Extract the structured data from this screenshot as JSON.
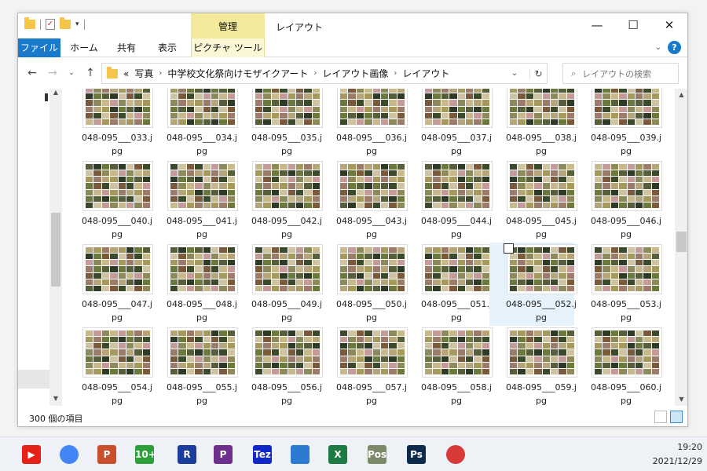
{
  "window": {
    "title": "レイアウト",
    "context_tab_group": "管理",
    "controls": {
      "minimize": "—",
      "maximize": "☐",
      "close": "✕"
    }
  },
  "ribbon": {
    "tabs": [
      {
        "label": "ファイル",
        "active": true
      },
      {
        "label": "ホーム"
      },
      {
        "label": "共有"
      },
      {
        "label": "表示"
      },
      {
        "label": "ピクチャ ツール"
      }
    ],
    "expand_icon": "chevron-down-icon",
    "help_label": "?"
  },
  "address_bar": {
    "overflow": "«",
    "crumbs": [
      "写真",
      "中学校文化祭向けモザイクアート",
      "レイアウト画像",
      "レイアウト"
    ]
  },
  "search": {
    "placeholder": "レイアウトの検索"
  },
  "files": [
    {
      "name": "048-095___033.jpg"
    },
    {
      "name": "048-095___034.jpg"
    },
    {
      "name": "048-095___035.jpg"
    },
    {
      "name": "048-095___036.jpg"
    },
    {
      "name": "048-095___037.jpg"
    },
    {
      "name": "048-095___038.jpg"
    },
    {
      "name": "048-095___039.jpg"
    },
    {
      "name": "048-095___040.jpg"
    },
    {
      "name": "048-095___041.jpg"
    },
    {
      "name": "048-095___042.jpg"
    },
    {
      "name": "048-095___043.jpg"
    },
    {
      "name": "048-095___044.jpg"
    },
    {
      "name": "048-095___045.jpg"
    },
    {
      "name": "048-095___046.jpg"
    },
    {
      "name": "048-095___047.jpg"
    },
    {
      "name": "048-095___048.jpg"
    },
    {
      "name": "048-095___049.jpg"
    },
    {
      "name": "048-095___050.jpg"
    },
    {
      "name": "048-095___051.jpg"
    },
    {
      "name": "048-095___052.jpg",
      "selected": true
    },
    {
      "name": "048-095___053.jpg"
    },
    {
      "name": "048-095___054.jpg"
    },
    {
      "name": "048-095___055.jpg"
    },
    {
      "name": "048-095___056.jpg"
    },
    {
      "name": "048-095___057.jpg"
    },
    {
      "name": "048-095___058.jpg"
    },
    {
      "name": "048-095___059.jpg"
    },
    {
      "name": "048-095___060.jpg"
    }
  ],
  "status": {
    "item_count": "300 個の項目"
  },
  "taskbar": {
    "apps": [
      {
        "icon": "youtube-icon",
        "label": "▶",
        "color": "#e62117"
      },
      {
        "icon": "chrome-icon",
        "label": "",
        "color": "#4285f4"
      },
      {
        "icon": "powerpoint-icon",
        "label": "P",
        "color": "#c94f2c"
      },
      {
        "icon": "ten-plus-app-icon",
        "label": "10+",
        "color": "#2e9e3a"
      },
      {
        "icon": "r-app-icon",
        "label": "R",
        "color": "#1a3d9e"
      },
      {
        "icon": "p-app-icon",
        "label": "P",
        "color": "#6d2e8c"
      },
      {
        "icon": "tez-app-icon",
        "label": "Tez",
        "color": "#1028c8"
      },
      {
        "icon": "photos-icon",
        "label": "",
        "color": "#2a7bd1"
      },
      {
        "icon": "excel-icon",
        "label": "X",
        "color": "#1d7a43"
      },
      {
        "icon": "pos-app-icon",
        "label": "Pos",
        "color": "#7c8a6a"
      },
      {
        "icon": "photoshop-icon",
        "label": "Ps",
        "color": "#0c2b4b"
      },
      {
        "icon": "camera-app-icon",
        "label": "",
        "color": "#d83a3a"
      }
    ],
    "time": "19:20",
    "date": "2021/12/29"
  },
  "colors": {
    "accent": "#1979ca",
    "context_tab": "#f2ea9a",
    "selected": "#e5f1fb"
  }
}
